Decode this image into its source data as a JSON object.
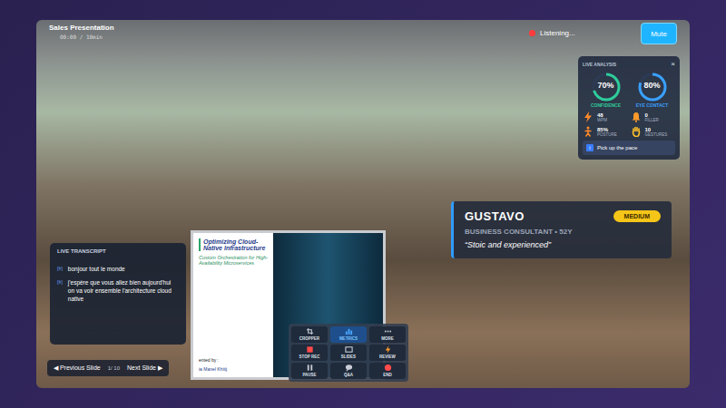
{
  "window": {
    "title": "Sales Presentation",
    "timer": "00:00 / 10min"
  },
  "status": {
    "label": "Listening..."
  },
  "mute_button": {
    "label": "Mute"
  },
  "analysis": {
    "title": "LIVE ANALYSIS",
    "close": "×",
    "rings": [
      {
        "value": "70%",
        "label": "CONFIDENCE",
        "level": 0.7,
        "color": "#2ecc9a"
      },
      {
        "value": "80%",
        "label": "EYE CONTACT",
        "level": 0.8,
        "color": "#3aa0ff"
      }
    ],
    "metrics": [
      {
        "value": "48",
        "label": "WPM",
        "kind": "bolt",
        "color": "#ff8a2a"
      },
      {
        "value": "0",
        "label": "FILLER",
        "kind": "bell",
        "color": "#ff9a2a"
      },
      {
        "value": "85%",
        "label": "POSTURE",
        "kind": "person",
        "color": "#ff8a2a"
      },
      {
        "value": "10",
        "label": "GESTURES",
        "kind": "hand",
        "color": "#ffc02a"
      }
    ],
    "tip": {
      "badge": "i",
      "text": "Pick up the pace"
    }
  },
  "persona": {
    "name": "GUSTAVO",
    "difficulty": "MEDIUM",
    "role": "BUSINESS CONSULTANT • 52Y",
    "quote": "“Stoic and experienced”"
  },
  "transcript": {
    "title": "LIVE TRANSCRIPT",
    "entries": [
      {
        "tag": "[fr]",
        "text": "bonjour tout le monde"
      },
      {
        "tag": "[fr]",
        "text": "j'espère que vous allez bien aujourd'hui on va voir ensemble l'architecture cloud native"
      }
    ]
  },
  "slide": {
    "title": "Optimizing Cloud-Native Infrastructure",
    "subtitle": "Custom Orchestration for High-Availability Microservices",
    "presented": "ented by :",
    "author": "ia Manel Khitij"
  },
  "slide_nav": {
    "previous": "◀ Previous Slide",
    "page": "1/ 10",
    "next": "Next Slide ▶"
  },
  "toolbar": {
    "groups": [
      [
        {
          "label": "CROPPER",
          "kind": "crop",
          "color": "#c9ced8",
          "selected": false
        },
        {
          "label": "STOP REC",
          "kind": "stop",
          "color": "#ff4b4b",
          "selected": false
        },
        {
          "label": "PAUSE",
          "kind": "pause",
          "color": "#c9ced8",
          "selected": false
        }
      ],
      [
        {
          "label": "METRICS",
          "kind": "chart",
          "color": "#4aa8ff",
          "selected": true
        },
        {
          "label": "SLIDES",
          "kind": "slides",
          "color": "#c9ced8",
          "selected": false
        },
        {
          "label": "Q&A",
          "kind": "chat",
          "color": "#c9ced8",
          "selected": false
        }
      ],
      [
        {
          "label": "MORE",
          "kind": "more",
          "color": "#c9ced8",
          "selected": false
        },
        {
          "label": "REVIEW",
          "kind": "bolt",
          "color": "#ff9a2a",
          "selected": false
        },
        {
          "label": "END",
          "kind": "end",
          "color": "#ff4b4b",
          "selected": false
        }
      ]
    ]
  }
}
